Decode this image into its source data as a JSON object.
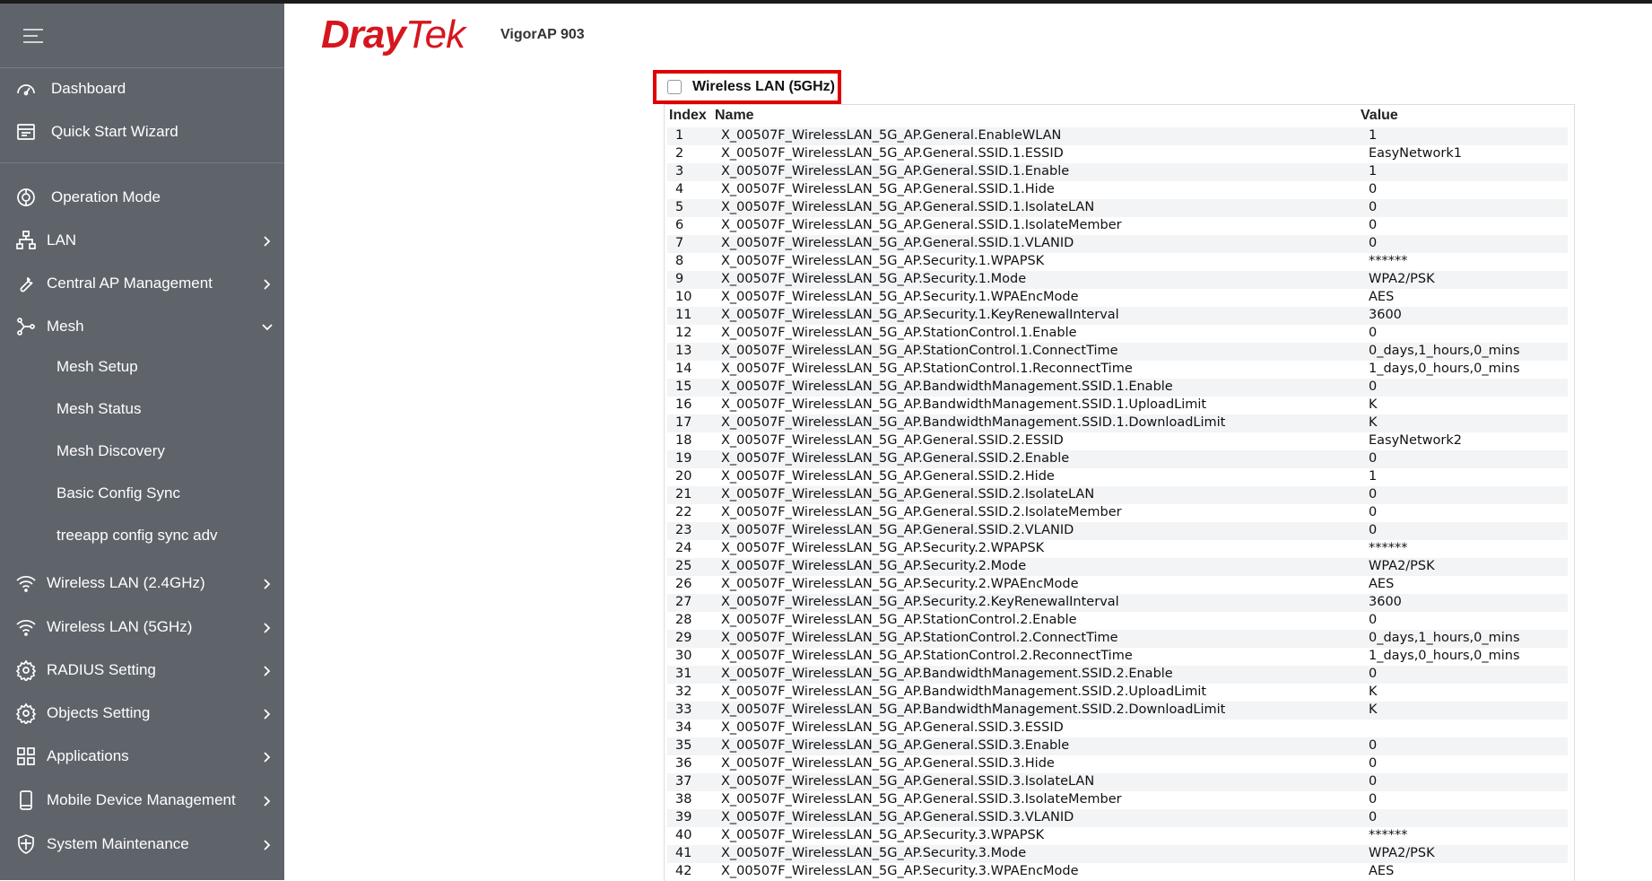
{
  "brand": {
    "logo_dray": "Dray",
    "logo_tek": "Tek",
    "model": "VigorAP 903",
    "logo_color": "#d6161e"
  },
  "sidebar": {
    "background": "#5f646b",
    "top_items": [
      {
        "label": "Dashboard",
        "icon": "dashboard-icon"
      },
      {
        "label": "Quick Start Wizard",
        "icon": "wizard-icon"
      }
    ],
    "items": [
      {
        "label": "Operation Mode",
        "icon": "operation-mode-icon",
        "chevron": ""
      },
      {
        "label": "LAN",
        "icon": "lan-icon",
        "chevron": "right"
      },
      {
        "label": "Central AP Management",
        "icon": "wrench-icon",
        "chevron": "right"
      },
      {
        "label": "Mesh",
        "icon": "mesh-icon",
        "chevron": "down"
      }
    ],
    "mesh_sub": [
      "Mesh Setup",
      "Mesh Status",
      "Mesh Discovery",
      "Basic Config Sync",
      "treeapp config sync adv"
    ],
    "lower_items": [
      {
        "label": "Wireless LAN (2.4GHz)",
        "icon": "wifi-icon"
      },
      {
        "label": "Wireless LAN (5GHz)",
        "icon": "wifi-icon"
      },
      {
        "label": "RADIUS Setting",
        "icon": "gear-icon"
      },
      {
        "label": "Objects Setting",
        "icon": "gear-icon"
      },
      {
        "label": "Applications",
        "icon": "apps-icon"
      },
      {
        "label": "Mobile Device Management",
        "icon": "mobile-icon"
      },
      {
        "label": "System Maintenance",
        "icon": "maintenance-icon"
      }
    ]
  },
  "section": {
    "title": "Wireless LAN (5GHz)",
    "checked": false,
    "highlight_color": "#e00000"
  },
  "table": {
    "headers": {
      "index": "Index",
      "name": "Name",
      "value": "Value"
    },
    "rows": [
      [
        "1",
        "X_00507F_WirelessLAN_5G_AP.General.EnableWLAN",
        "1"
      ],
      [
        "2",
        "X_00507F_WirelessLAN_5G_AP.General.SSID.1.ESSID",
        "EasyNetwork1"
      ],
      [
        "3",
        "X_00507F_WirelessLAN_5G_AP.General.SSID.1.Enable",
        "1"
      ],
      [
        "4",
        "X_00507F_WirelessLAN_5G_AP.General.SSID.1.Hide",
        "0"
      ],
      [
        "5",
        "X_00507F_WirelessLAN_5G_AP.General.SSID.1.IsolateLAN",
        "0"
      ],
      [
        "6",
        "X_00507F_WirelessLAN_5G_AP.General.SSID.1.IsolateMember",
        "0"
      ],
      [
        "7",
        "X_00507F_WirelessLAN_5G_AP.General.SSID.1.VLANID",
        "0"
      ],
      [
        "8",
        "X_00507F_WirelessLAN_5G_AP.Security.1.WPAPSK",
        "******"
      ],
      [
        "9",
        "X_00507F_WirelessLAN_5G_AP.Security.1.Mode",
        "WPA2/PSK"
      ],
      [
        "10",
        "X_00507F_WirelessLAN_5G_AP.Security.1.WPAEncMode",
        "AES"
      ],
      [
        "11",
        "X_00507F_WirelessLAN_5G_AP.Security.1.KeyRenewalInterval",
        "3600"
      ],
      [
        "12",
        "X_00507F_WirelessLAN_5G_AP.StationControl.1.Enable",
        "0"
      ],
      [
        "13",
        "X_00507F_WirelessLAN_5G_AP.StationControl.1.ConnectTime",
        "0_days,1_hours,0_mins"
      ],
      [
        "14",
        "X_00507F_WirelessLAN_5G_AP.StationControl.1.ReconnectTime",
        "1_days,0_hours,0_mins"
      ],
      [
        "15",
        "X_00507F_WirelessLAN_5G_AP.BandwidthManagement.SSID.1.Enable",
        "0"
      ],
      [
        "16",
        "X_00507F_WirelessLAN_5G_AP.BandwidthManagement.SSID.1.UploadLimit",
        "K"
      ],
      [
        "17",
        "X_00507F_WirelessLAN_5G_AP.BandwidthManagement.SSID.1.DownloadLimit",
        "K"
      ],
      [
        "18",
        "X_00507F_WirelessLAN_5G_AP.General.SSID.2.ESSID",
        "EasyNetwork2"
      ],
      [
        "19",
        "X_00507F_WirelessLAN_5G_AP.General.SSID.2.Enable",
        "0"
      ],
      [
        "20",
        "X_00507F_WirelessLAN_5G_AP.General.SSID.2.Hide",
        "1"
      ],
      [
        "21",
        "X_00507F_WirelessLAN_5G_AP.General.SSID.2.IsolateLAN",
        "0"
      ],
      [
        "22",
        "X_00507F_WirelessLAN_5G_AP.General.SSID.2.IsolateMember",
        "0"
      ],
      [
        "23",
        "X_00507F_WirelessLAN_5G_AP.General.SSID.2.VLANID",
        "0"
      ],
      [
        "24",
        "X_00507F_WirelessLAN_5G_AP.Security.2.WPAPSK",
        "******"
      ],
      [
        "25",
        "X_00507F_WirelessLAN_5G_AP.Security.2.Mode",
        "WPA2/PSK"
      ],
      [
        "26",
        "X_00507F_WirelessLAN_5G_AP.Security.2.WPAEncMode",
        "AES"
      ],
      [
        "27",
        "X_00507F_WirelessLAN_5G_AP.Security.2.KeyRenewalInterval",
        "3600"
      ],
      [
        "28",
        "X_00507F_WirelessLAN_5G_AP.StationControl.2.Enable",
        "0"
      ],
      [
        "29",
        "X_00507F_WirelessLAN_5G_AP.StationControl.2.ConnectTime",
        "0_days,1_hours,0_mins"
      ],
      [
        "30",
        "X_00507F_WirelessLAN_5G_AP.StationControl.2.ReconnectTime",
        "1_days,0_hours,0_mins"
      ],
      [
        "31",
        "X_00507F_WirelessLAN_5G_AP.BandwidthManagement.SSID.2.Enable",
        "0"
      ],
      [
        "32",
        "X_00507F_WirelessLAN_5G_AP.BandwidthManagement.SSID.2.UploadLimit",
        "K"
      ],
      [
        "33",
        "X_00507F_WirelessLAN_5G_AP.BandwidthManagement.SSID.2.DownloadLimit",
        "K"
      ],
      [
        "34",
        "X_00507F_WirelessLAN_5G_AP.General.SSID.3.ESSID",
        ""
      ],
      [
        "35",
        "X_00507F_WirelessLAN_5G_AP.General.SSID.3.Enable",
        "0"
      ],
      [
        "36",
        "X_00507F_WirelessLAN_5G_AP.General.SSID.3.Hide",
        "0"
      ],
      [
        "37",
        "X_00507F_WirelessLAN_5G_AP.General.SSID.3.IsolateLAN",
        "0"
      ],
      [
        "38",
        "X_00507F_WirelessLAN_5G_AP.General.SSID.3.IsolateMember",
        "0"
      ],
      [
        "39",
        "X_00507F_WirelessLAN_5G_AP.General.SSID.3.VLANID",
        "0"
      ],
      [
        "40",
        "X_00507F_WirelessLAN_5G_AP.Security.3.WPAPSK",
        "******"
      ],
      [
        "41",
        "X_00507F_WirelessLAN_5G_AP.Security.3.Mode",
        "WPA2/PSK"
      ],
      [
        "42",
        "X_00507F_WirelessLAN_5G_AP.Security.3.WPAEncMode",
        "AES"
      ]
    ]
  }
}
